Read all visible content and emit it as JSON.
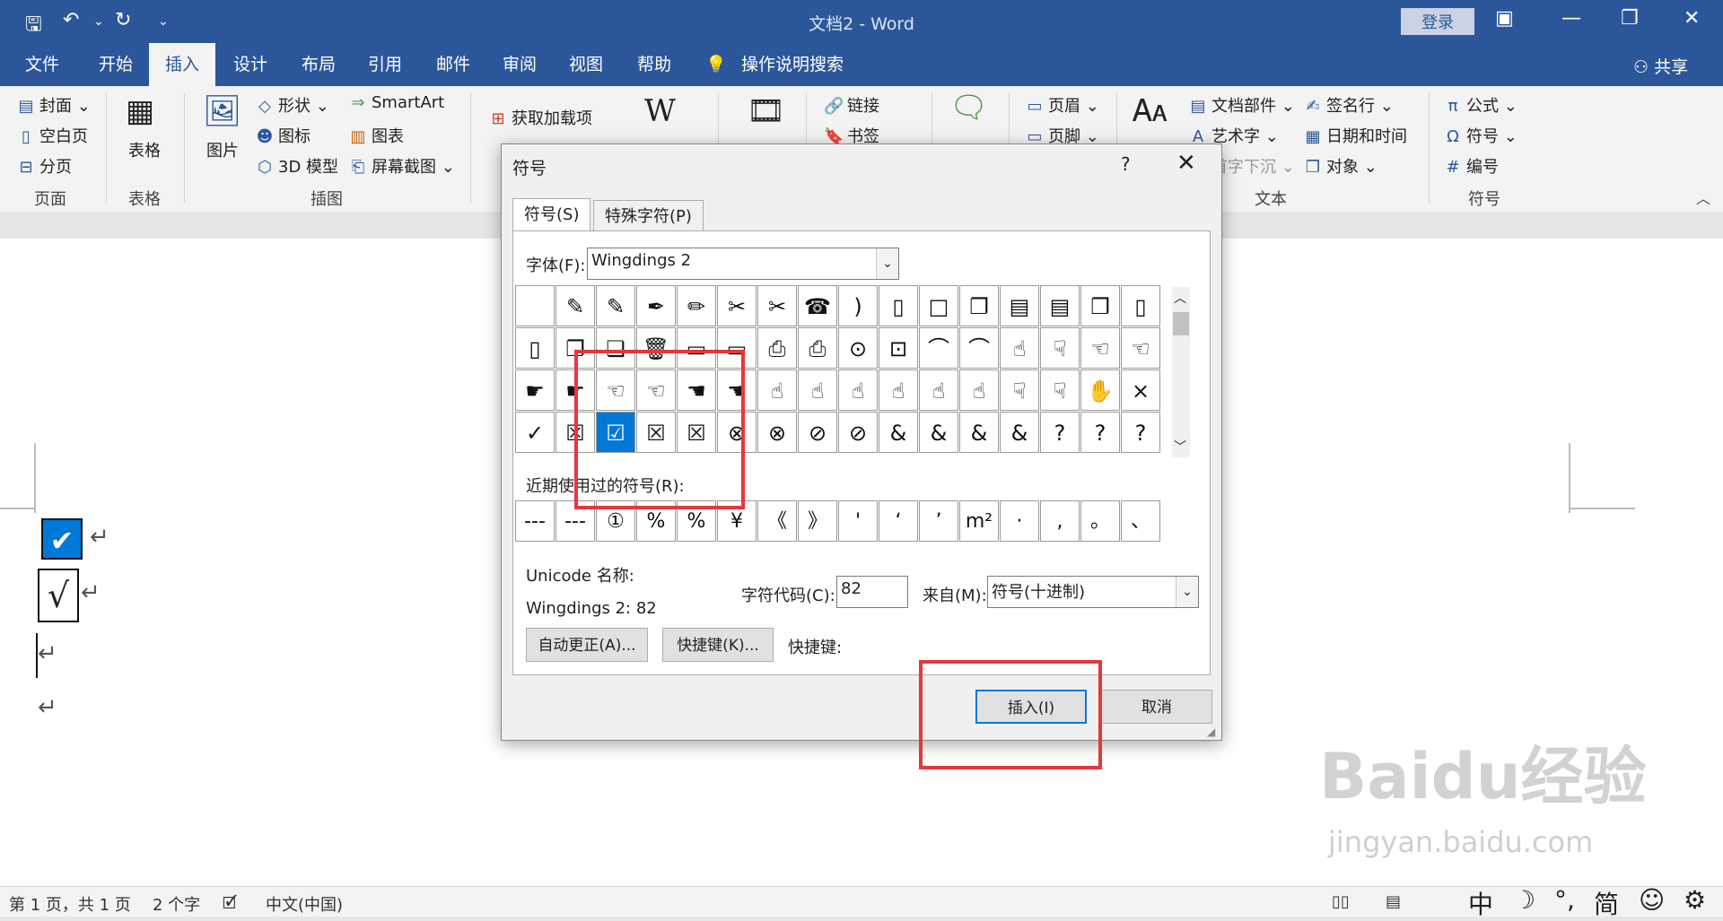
{
  "titlebar": {
    "title": "文档2 - Word",
    "login": "登录",
    "save_icon": "save-icon",
    "undo_icon": "undo-icon",
    "redo_icon": "redo-icon"
  },
  "menubar": {
    "tabs": [
      "文件",
      "开始",
      "插入",
      "设计",
      "布局",
      "引用",
      "邮件",
      "审阅",
      "视图",
      "帮助",
      "操作说明搜索"
    ],
    "active": "插入",
    "share": "共享"
  },
  "ribbon": {
    "page_group": {
      "items": [
        "封面",
        "空白页",
        "分页"
      ],
      "label": "页面"
    },
    "table_group": {
      "item": "表格",
      "label": "表格"
    },
    "illus_group": {
      "items": [
        "图片",
        "形状",
        "图标",
        "3D 模型",
        "SmartArt",
        "图表",
        "屏幕截图"
      ],
      "label": "插图"
    },
    "addins": {
      "get": "获取加载项",
      "wiki": "Wikipedia"
    },
    "links": {
      "link": "链接",
      "bookmark": "书签"
    },
    "header_footer": {
      "header": "页眉",
      "footer": "页脚"
    },
    "text_group": {
      "items": [
        "文档部件",
        "艺术字",
        "首字下沉",
        "签名行",
        "日期和时间",
        "对象"
      ],
      "label": "文本"
    },
    "symbols_group": {
      "items": [
        "公式",
        "符号",
        "编号"
      ],
      "label": "符号"
    }
  },
  "dialog": {
    "title": "符号",
    "help": "?",
    "tabs": [
      "符号(S)",
      "特殊字符(P)"
    ],
    "font_label": "字体(F):",
    "font_value": "Wingdings 2",
    "grid_rows": [
      [
        "",
        "✎",
        "✎",
        "✒",
        "✏",
        "✂",
        "✂",
        "☎",
        ")",
        "▯",
        "□",
        "❐",
        "▤",
        "▤",
        "❒",
        "▯"
      ],
      [
        "▯",
        "❐",
        "❏",
        "🗑",
        "▭",
        "▭",
        "⎙",
        "⎙",
        "⊙",
        "⊡",
        "⌒",
        "⌒",
        "☝",
        "☟",
        "☜",
        "☜"
      ],
      [
        "☛",
        "☛",
        "☜",
        "☜",
        "☚",
        "☚",
        "☝",
        "☝",
        "☝",
        "☝",
        "☝",
        "☝",
        "☟",
        "☟",
        "✋",
        "×"
      ],
      [
        "✓",
        "☒",
        "☑",
        "☒",
        "☒",
        "⊗",
        "⊗",
        "⊘",
        "⊘",
        "&",
        "&",
        "&",
        "&",
        "?",
        "?",
        "?"
      ]
    ],
    "selected_cell": "☑",
    "recent_label": "近期使用过的符号(R):",
    "recent": [
      "---",
      "---",
      "①",
      "%",
      "%",
      "¥",
      "《",
      "》",
      "'",
      "‘",
      "’",
      "m²",
      "·",
      ",",
      "。",
      "、"
    ],
    "unicode_label": "Unicode 名称:",
    "unicode_value": "Wingdings 2: 82",
    "code_label": "字符代码(C):",
    "code_value": "82",
    "from_label": "来自(M):",
    "from_value": "符号(十进制)",
    "autocorrect": "自动更正(A)...",
    "shortcut_btn": "快捷键(K)...",
    "shortcut_label": "快捷键:",
    "insert": "插入(I)",
    "cancel": "取消"
  },
  "document": {
    "checkbox_mark": "✔",
    "sqrt_mark": "√",
    "para_mark": "↵"
  },
  "statusbar": {
    "page": "第 1 页，共 1 页",
    "words": "2 个字",
    "lang": "中文(中国)",
    "ime": [
      "中",
      "☽",
      "°,",
      "简",
      "☺",
      "⚙"
    ]
  },
  "watermark": {
    "brand": "Baidu经验",
    "url": "jingyan.baidu.com"
  },
  "colors": {
    "brand": "#2b579a",
    "selection": "#0078d7",
    "highlight": "#e8363d"
  }
}
